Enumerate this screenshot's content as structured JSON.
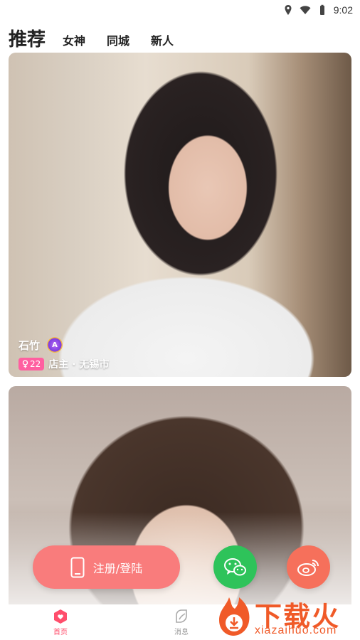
{
  "status_bar": {
    "time": "9:02"
  },
  "tabs": [
    {
      "label": "推荐"
    },
    {
      "label": "女神"
    },
    {
      "label": "同城"
    },
    {
      "label": "新人"
    }
  ],
  "cards": [
    {
      "name": "石竹",
      "badge": "A",
      "age": "22",
      "meta": "店主 · 无锡市"
    }
  ],
  "actions": {
    "register_label": "注册/登陆"
  },
  "nav": {
    "items": [
      {
        "label": "首页",
        "icon": "home-heart-icon",
        "active": true
      },
      {
        "label": "消息",
        "icon": "message-leaf-icon",
        "active": false
      }
    ]
  },
  "watermark": {
    "title": "下载火",
    "subtitle": "xiazaihuo.com"
  },
  "colors": {
    "accent": "#ff4e6c",
    "register": "#f97c7c",
    "wechat": "#2ec35a",
    "weibo": "#f6705b",
    "gender_chip": "#ff5fa0",
    "watermark": "#f05a28"
  }
}
